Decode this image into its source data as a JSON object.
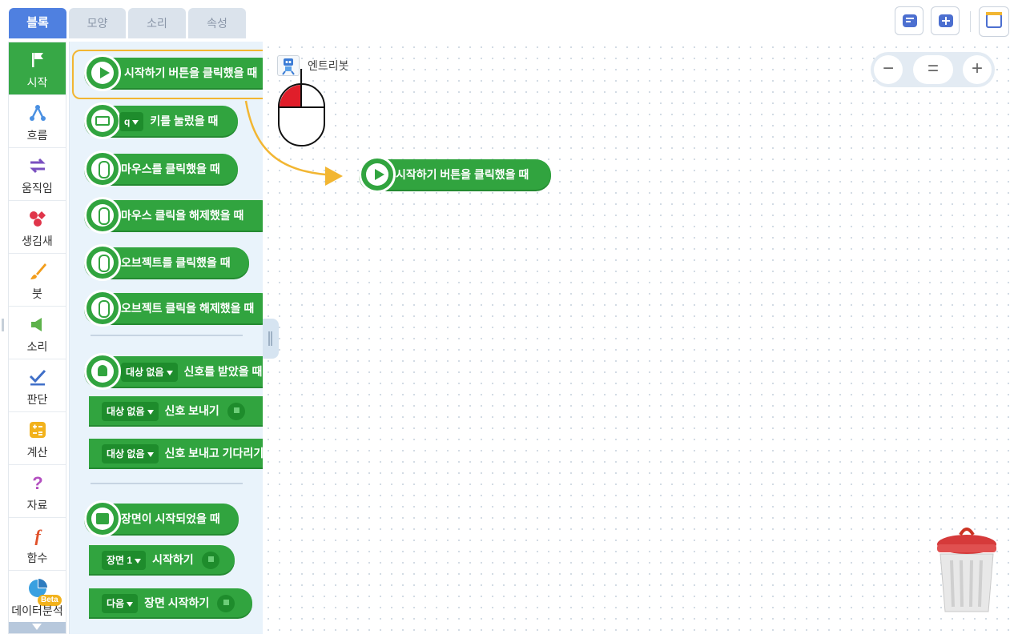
{
  "tabs": [
    "블록",
    "모양",
    "소리",
    "속성"
  ],
  "categories": [
    {
      "label": "시작",
      "icon": "flag-icon"
    },
    {
      "label": "흐름",
      "icon": "flow-icon"
    },
    {
      "label": "움직임",
      "icon": "move-arrows-icon"
    },
    {
      "label": "생김새",
      "icon": "shapes-icon"
    },
    {
      "label": "붓",
      "icon": "brush-icon"
    },
    {
      "label": "소리",
      "icon": "speaker-icon"
    },
    {
      "label": "판단",
      "icon": "check-icon"
    },
    {
      "label": "계산",
      "icon": "calculator-icon"
    },
    {
      "label": "자료",
      "icon": "question-icon"
    },
    {
      "label": "함수",
      "icon": "function-icon"
    },
    {
      "label": "데이터분석",
      "icon": "pie-chart-icon",
      "badge": "Beta"
    }
  ],
  "palette": {
    "when_start_clicked": "시작하기 버튼을 클릭했을 때",
    "key_value": "q",
    "key_pressed": "키를 눌렀을 때",
    "mouse_clicked": "마우스를 클릭했을 때",
    "mouse_released": "마우스 클릭을 해제했을 때",
    "object_clicked": "오브젝트를 클릭했을 때",
    "object_released": "오브젝트 클릭을 해제했을 때",
    "signal_target": "대상 없음",
    "signal_received": "신호를 받았을 때",
    "signal_send": "신호 보내기",
    "signal_send_wait": "신호 보내고 기다리기",
    "scene_started": "장면이 시작되었을 때",
    "scene_value": "장면 1",
    "scene_start": "시작하기",
    "next_value": "다음",
    "next_scene_start": "장면 시작하기"
  },
  "canvas": {
    "object_name": "엔트리봇",
    "placed_block": "시작하기 버튼을 클릭했을 때",
    "zoom_out": "−",
    "zoom_reset": "=",
    "zoom_in": "+"
  },
  "colors": {
    "block_green": "#31a43f",
    "tab_active": "#4f80e0",
    "highlight": "#f2b632"
  }
}
